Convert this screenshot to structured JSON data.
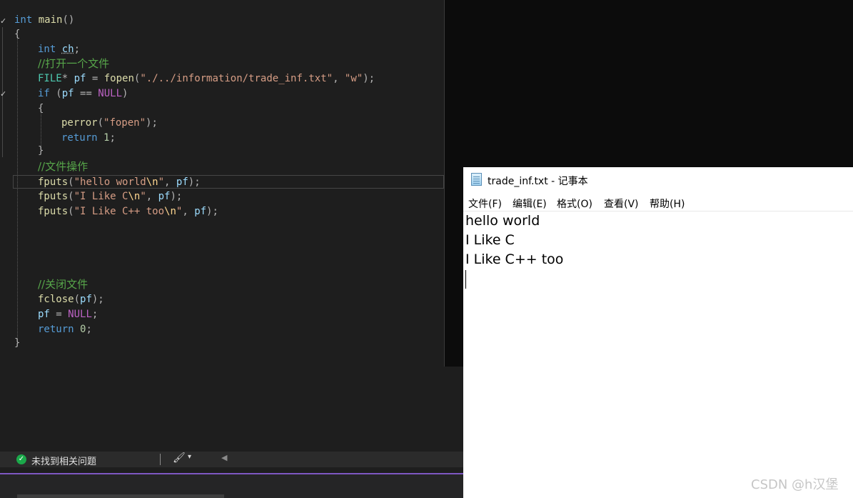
{
  "editor": {
    "lines": {
      "main_sig": {
        "kw": "int",
        "name": "main",
        "parens": "()"
      },
      "open_brace": "{",
      "decl_ch": {
        "kw": "int",
        "var": "ch",
        "semi": ";"
      },
      "comment_open": "//打开一个文件",
      "fopen_line": {
        "type": "FILE",
        "star": "*",
        "var": "pf",
        "eq": " = ",
        "fn": "fopen",
        "open": "(",
        "path": "\"./../information/trade_inf.txt\"",
        "comma": ", ",
        "mode": "\"w\"",
        "close": ");"
      },
      "if_line": {
        "kw": "if",
        "open": " (",
        "var": "pf",
        "op": " == ",
        "macro": "NULL",
        "close": ")"
      },
      "if_open_brace": "{",
      "perror_line": {
        "fn": "perror",
        "open": "(",
        "arg": "\"fopen\"",
        "close": ");"
      },
      "return_1": {
        "kw": "return",
        "num": " 1",
        "semi": ";"
      },
      "if_close_brace": "}",
      "comment_ops": "//文件操作",
      "fputs_1": {
        "fn": "fputs",
        "open": "(",
        "s1": "\"hello world",
        "esc": "\\n",
        "s2": "\"",
        "comma": ", ",
        "var": "pf",
        "close": ");"
      },
      "fputs_2": {
        "fn": "fputs",
        "open": "(",
        "s1": "\"I Like C",
        "esc": "\\n",
        "s2": "\"",
        "comma": ", ",
        "var": "pf",
        "close": ");"
      },
      "fputs_3": {
        "fn": "fputs",
        "open": "(",
        "s1": "\"I Like C++ too",
        "esc": "\\n",
        "s2": "\"",
        "comma": ", ",
        "var": "pf",
        "close": ");"
      },
      "comment_close": "//关闭文件",
      "fclose_line": {
        "fn": "fclose",
        "open": "(",
        "var": "pf",
        "close": ");"
      },
      "null_assign": {
        "var": "pf",
        "eq": " = ",
        "macro": "NULL",
        "semi": ";"
      },
      "return_0": {
        "kw": "return",
        "num": " 0",
        "semi": ";"
      },
      "close_brace": "}"
    },
    "collapse_mark": "✓"
  },
  "statusbar": {
    "ok_icon": "check-circle-icon",
    "ok_glyph": "✓",
    "message": "未找到相关问题",
    "brush_icon": "cleanup-brush-icon",
    "brush_glyph": "🖌",
    "dropdown_glyph": "▾",
    "scroll_glyph": "◀"
  },
  "notepad": {
    "title": "trade_inf.txt - 记事本",
    "menu": [
      "文件(F)",
      "编辑(E)",
      "格式(O)",
      "查看(V)",
      "帮助(H)"
    ],
    "content_lines": [
      "hello world",
      "I Like C",
      "I Like C++ too"
    ]
  },
  "watermark": "CSDN @h汉堡",
  "colors": {
    "editor_bg": "#1e1e1e",
    "keyword": "#569cd6",
    "function": "#dcdcaa",
    "string": "#d69d85",
    "comment": "#57a64a",
    "accent": "#7e57c2"
  }
}
